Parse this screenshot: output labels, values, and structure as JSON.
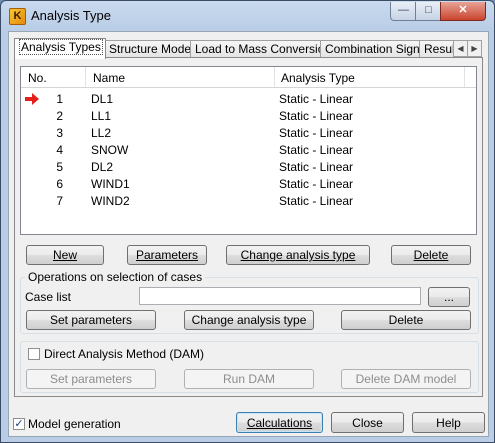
{
  "window": {
    "title": "Analysis Type",
    "app_icon_glyph": "K"
  },
  "tabs": [
    "Analysis Types",
    "Structure Model",
    "Load to Mass Conversion",
    "Combination Sign",
    "Result I"
  ],
  "list": {
    "headers": {
      "no": "No.",
      "name": "Name",
      "type": "Analysis Type"
    },
    "rows": [
      {
        "no": "1",
        "name": "DL1",
        "type": "Static - Linear"
      },
      {
        "no": "2",
        "name": "LL1",
        "type": "Static - Linear"
      },
      {
        "no": "3",
        "name": "LL2",
        "type": "Static - Linear"
      },
      {
        "no": "4",
        "name": "SNOW",
        "type": "Static - Linear"
      },
      {
        "no": "5",
        "name": "DL2",
        "type": "Static - Linear"
      },
      {
        "no": "6",
        "name": "WIND1",
        "type": "Static - Linear"
      },
      {
        "no": "7",
        "name": "WIND2",
        "type": "Static - Linear"
      }
    ]
  },
  "buttons": {
    "new": "New",
    "parameters": "Parameters",
    "change_analysis_type": "Change analysis type",
    "delete": "Delete"
  },
  "selection": {
    "group_label": "Operations on selection of cases",
    "case_list_label": "Case list",
    "case_list_value": "",
    "browse": "...",
    "set_parameters": "Set parameters",
    "change_analysis_type": "Change analysis type",
    "delete": "Delete"
  },
  "dam": {
    "checkbox_label": "Direct Analysis Method (DAM)",
    "set_parameters": "Set parameters",
    "run": "Run DAM",
    "delete_model": "Delete DAM model"
  },
  "footer": {
    "model_generation": "Model generation",
    "calculations": "Calculations",
    "close": "Close",
    "help": "Help"
  },
  "colors": {
    "accent_arrow": "#e3201b",
    "title_bar": "#b9cde6"
  }
}
